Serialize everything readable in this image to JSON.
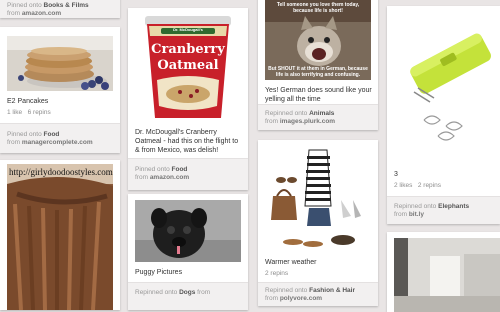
{
  "pins": [
    {
      "id": "top-books",
      "pinned_prefix": "Pinned onto",
      "board": "Books & Films",
      "from_prefix": "from",
      "source": "amazon.com"
    },
    {
      "id": "pancakes",
      "description": "E2 Pancakes",
      "likes": "1 like",
      "repins": "6 repins",
      "pinned_prefix": "Pinned onto",
      "board": "Food",
      "from_prefix": "from",
      "source": "managercomplete.com"
    },
    {
      "id": "waterfall-braid",
      "image_text": "http://girlydoodoostyles.com"
    },
    {
      "id": "oatmeal",
      "image_brand": "Dr. McDougall's",
      "image_title_1": "Cranberry",
      "image_title_2": "Oatmeal",
      "description": "Dr. McDougall's Cranberry Oatmeal - had this on the flight to & from Mexico, was delish!",
      "pinned_prefix": "Pinned onto",
      "board": "Food",
      "from_prefix": "from",
      "source": "amazon.com"
    },
    {
      "id": "puggy",
      "description": "Puggy Pictures",
      "pinned_prefix": "Repinned onto",
      "board": "Dogs",
      "from_prefix": "from"
    },
    {
      "id": "german-cat",
      "meme_top": "Tell someone you love them today, because life is short!",
      "meme_bottom": "But SHOUT it at them in German, because life is also terrifying and confusing.",
      "description": "Yes! German does sound like your yelling all the time",
      "pinned_prefix": "Repinned onto",
      "board": "Animals",
      "from_prefix": "from",
      "source": "images.plurk.com"
    },
    {
      "id": "warmer-weather",
      "description": "Warmer weather",
      "repins": "2 repins",
      "pinned_prefix": "Repinned onto",
      "board": "Fashion & Hair",
      "from_prefix": "from",
      "source": "polyvore.com"
    },
    {
      "id": "clip-dispenser",
      "description": "3",
      "likes": "2 likes",
      "repins": "2 repins",
      "pinned_prefix": "Repinned onto",
      "board": "Elephants",
      "from_prefix": "from",
      "source": "bit.ly"
    }
  ],
  "colors": {
    "background": "#e9e5e5",
    "card": "#ffffff",
    "footer": "#f2f0f0",
    "oatmeal_red": "#c8202a",
    "clip_green": "#c4e23a"
  }
}
